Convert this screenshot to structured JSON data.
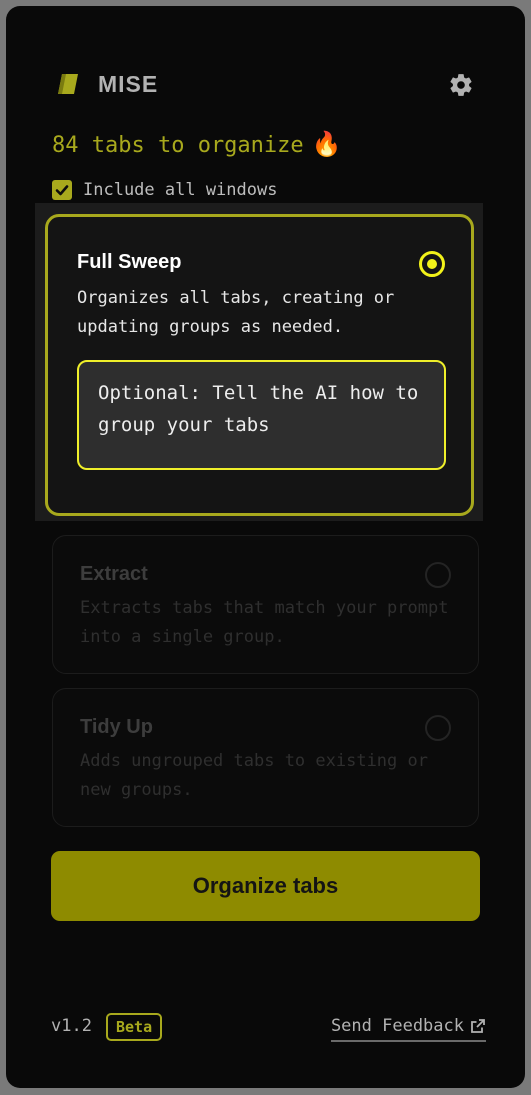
{
  "header": {
    "brand": "MISE",
    "logo_icon": "mise-logo-icon",
    "settings_icon": "gear-icon"
  },
  "summary": {
    "count_text": "84 tabs to organize",
    "emoji": "🔥"
  },
  "include_windows": {
    "label": "Include all windows",
    "checked": true
  },
  "modes": [
    {
      "title": "Full Sweep",
      "description": "Organizes all tabs, creating or updating groups as needed.",
      "selected": true
    },
    {
      "title": "Extract",
      "description": "Extracts tabs that match your prompt into a single group.",
      "selected": false
    },
    {
      "title": "Tidy Up",
      "description": "Adds ungrouped tabs to existing or new groups.",
      "selected": false
    }
  ],
  "prompt": {
    "placeholder": "Optional: Tell the AI how to group your tabs"
  },
  "actions": {
    "organize_label": "Organize tabs"
  },
  "footer": {
    "version": "v1.2",
    "badge": "Beta",
    "feedback_label": "Send Feedback",
    "feedback_icon": "external-link-icon"
  },
  "colors": {
    "accent": "#a8a91d",
    "highlight": "#f2f21a",
    "button": "#8e8b00",
    "background": "#090909"
  }
}
